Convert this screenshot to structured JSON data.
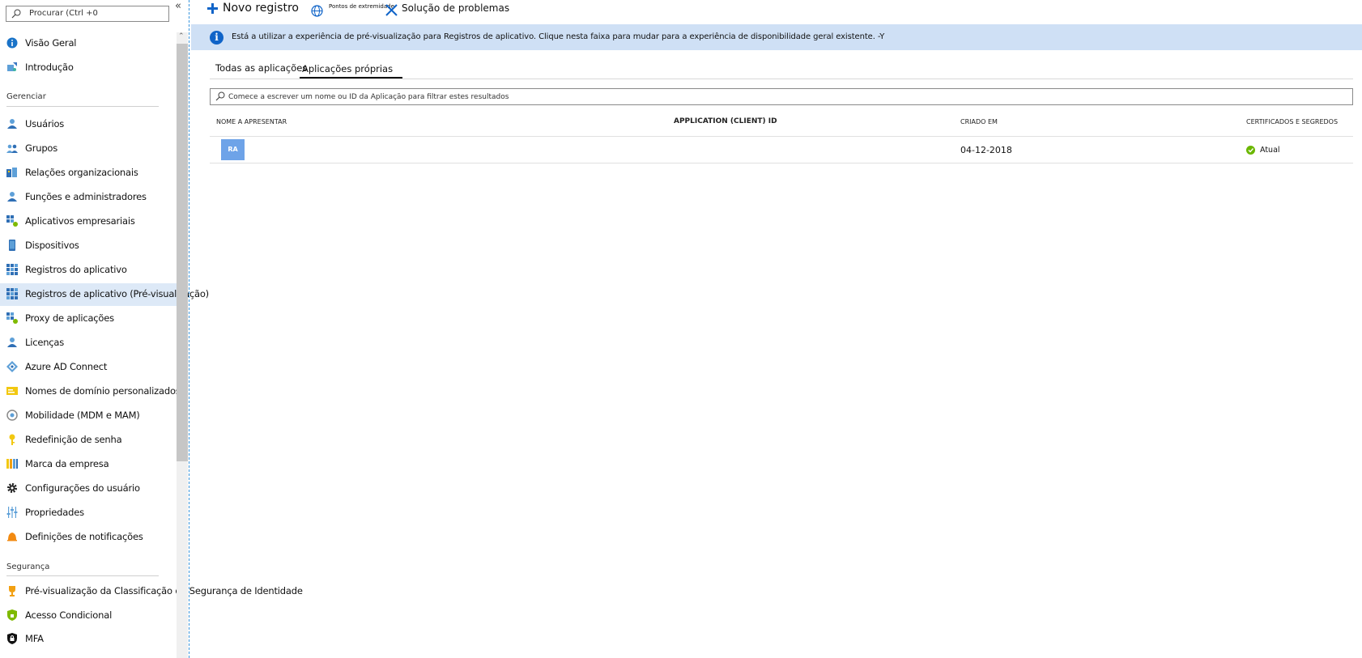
{
  "sidebar": {
    "search_placeholder": "Procurar (Ctrl +0",
    "collapse_label": "«",
    "top_items": [
      {
        "label": "Visão Geral",
        "icon": "info-circle-icon"
      },
      {
        "label": "Introdução",
        "icon": "quickstart-icon"
      }
    ],
    "section_manage": "Gerenciar",
    "manage_items": [
      {
        "label": "Usuários",
        "icon": "user-icon"
      },
      {
        "label": "Grupos",
        "icon": "group-icon"
      },
      {
        "label": "Relações organizacionais",
        "icon": "org-relations-icon"
      },
      {
        "label": "Funções e administradores",
        "icon": "roles-icon"
      },
      {
        "label": "Aplicativos empresariais",
        "icon": "enterprise-apps-icon"
      },
      {
        "label": "Dispositivos",
        "icon": "device-icon"
      },
      {
        "label": "Registros do aplicativo",
        "icon": "app-registrations-icon"
      },
      {
        "label": "Registros de aplicativo (Pré-visualização)",
        "icon": "app-registrations-preview-icon"
      },
      {
        "label": "Proxy de aplicações",
        "icon": "app-proxy-icon"
      },
      {
        "label": "Licenças",
        "icon": "licenses-icon"
      },
      {
        "label": "Azure AD Connect",
        "icon": "ad-connect-icon"
      },
      {
        "label": "Nomes de domínio personalizados",
        "icon": "domain-names-icon"
      },
      {
        "label": "Mobilidade (MDM e MAM)",
        "icon": "mobility-icon"
      },
      {
        "label": "Redefinição de senha",
        "icon": "key-icon"
      },
      {
        "label": "Marca da empresa",
        "icon": "branding-icon"
      },
      {
        "label": "Configurações do usuário",
        "icon": "gear-icon"
      },
      {
        "label": "Propriedades",
        "icon": "properties-icon"
      },
      {
        "label": "Definições de notificações",
        "icon": "bell-icon"
      }
    ],
    "section_security": "Segurança",
    "security_items": [
      {
        "label": "Pré-visualização da Classificação de Segurança de Identidade",
        "icon": "trophy-icon"
      },
      {
        "label": "Acesso Condicional",
        "icon": "shield-icon"
      },
      {
        "label": "MFA",
        "icon": "lock-icon"
      }
    ]
  },
  "toolbar": {
    "new_registration": "Novo registro",
    "endpoints": "Pontos de extremidade",
    "troubleshooting": "Solução de problemas"
  },
  "banner": {
    "message": "Está a utilizar a experiência de pré-visualização para Registros de aplicativo. Clique nesta faixa para mudar para a experiência de disponibilidade geral existente. -Y"
  },
  "tabs": {
    "all": "Todas as aplicações",
    "own": "Aplicações próprias"
  },
  "filter": {
    "placeholder": "Comece a escrever um nome ou ID da Aplicação para filtrar estes resultados"
  },
  "table": {
    "columns": [
      "NOME A APRESENTAR",
      "APPLICATION (CLIENT) ID",
      "CRIADO EM",
      "CERTIFICADOS E SEGREDOS"
    ],
    "rows": [
      {
        "avatar": "RA",
        "name": "",
        "client_id": "",
        "created": "04-12-2018",
        "status": "Atual"
      }
    ]
  },
  "colors": {
    "accent": "#1064c8",
    "banner_bg": "#cfe0f5",
    "selected_bg": "#dde9f7",
    "status_ok": "#6bb700",
    "avatar_bg": "#6ea3e8"
  }
}
